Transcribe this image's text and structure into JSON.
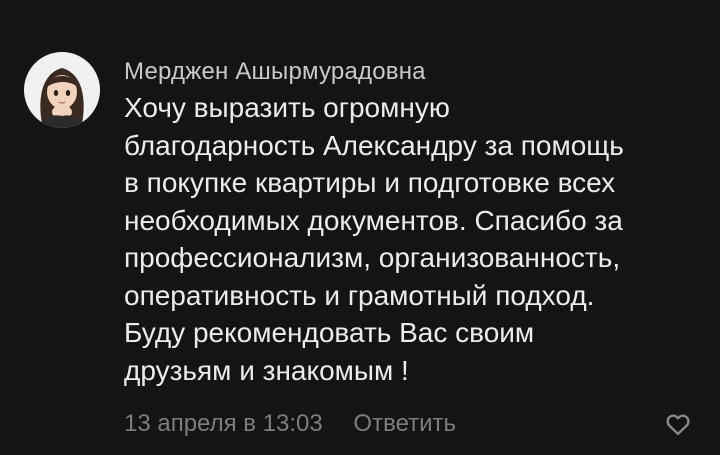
{
  "comment": {
    "author": "Мерджен Ашырмурадовна",
    "text_lines": [
      "Хочу выразить огромную",
      "благодарность Александру за помощь",
      "в покупке квартиры и подготовке всех",
      "необходимых документов. Спасибо за",
      "профессионализм, организованность,",
      "оперативность и грамотный подход.",
      "Буду рекомендовать Вас своим",
      "друзьям и знакомым !"
    ],
    "date": "13 апреля в 13:03",
    "reply_label": "Ответить",
    "avatar_icon": "user-avatar",
    "like_icon": "heart-outline-icon"
  },
  "colors": {
    "background": "#141414",
    "author": "#c9c9c9",
    "text": "#ececec",
    "meta": "#7d7d7d"
  }
}
